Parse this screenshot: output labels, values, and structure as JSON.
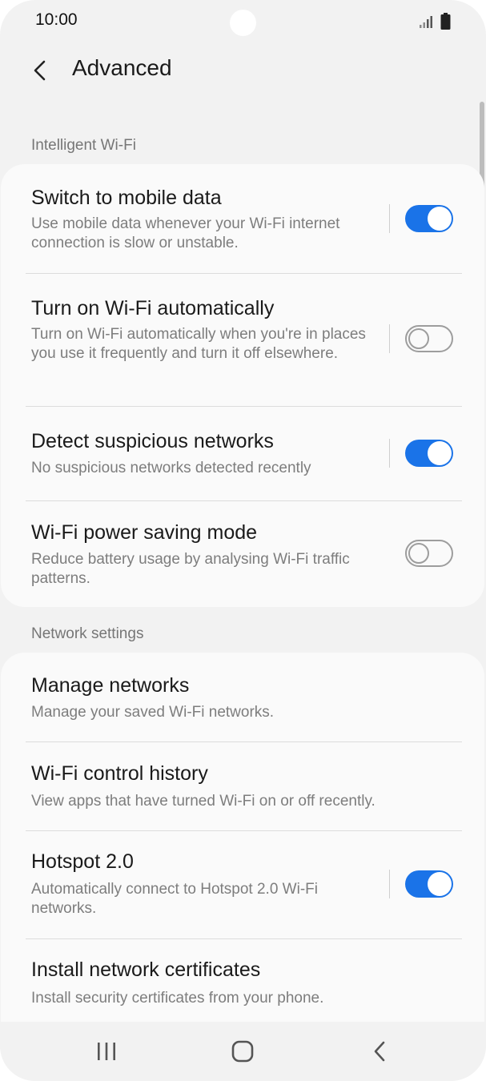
{
  "status_bar": {
    "time": "10:00",
    "icons": [
      "camera-cutout",
      "signal-icon",
      "battery-icon"
    ]
  },
  "header": {
    "back_icon": "chevron-left-icon",
    "title": "Advanced"
  },
  "sections": [
    {
      "header": "Intelligent Wi-Fi",
      "items": [
        {
          "title": "Switch to mobile data",
          "subtitle": "Use mobile data whenever your Wi-Fi internet connection is slow or unstable.",
          "toggle": true
        },
        {
          "title": "Turn on Wi-Fi automatically",
          "subtitle": "Turn on Wi-Fi automatically when you're in places you use it frequently and turn it off elsewhere.",
          "toggle": false
        },
        {
          "title": "Detect suspicious networks",
          "subtitle": "No suspicious networks detected recently",
          "toggle": true
        },
        {
          "title": "Wi-Fi power saving mode",
          "subtitle": "Reduce battery usage by analysing Wi-Fi traffic patterns.",
          "toggle": false
        }
      ]
    },
    {
      "header": "Network settings",
      "items": [
        {
          "title": "Manage networks",
          "subtitle": "Manage your saved Wi-Fi networks."
        },
        {
          "title": "Wi-Fi control history",
          "subtitle": "View apps that have turned Wi-Fi on or off recently."
        },
        {
          "title": "Hotspot 2.0",
          "subtitle": "Automatically connect to Hotspot 2.0 Wi-Fi networks.",
          "toggle": true
        },
        {
          "title": "Install network certificates",
          "subtitle": "Install security certificates from your phone."
        }
      ]
    }
  ],
  "nav_bar": {
    "buttons": [
      "recent-apps-icon",
      "home-icon",
      "back-icon"
    ]
  },
  "colors": {
    "accent": "#1a73e8",
    "background": "#f2f2f2",
    "card": "#fafafa"
  }
}
